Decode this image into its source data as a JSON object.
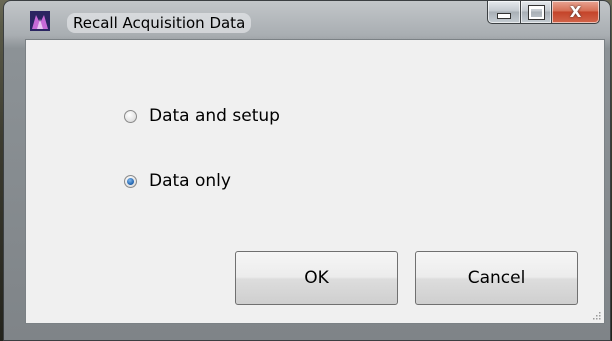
{
  "window": {
    "title": "Recall Acquisition Data",
    "close_glyph": "X"
  },
  "options": [
    {
      "label": "Data and setup",
      "checked": false
    },
    {
      "label": "Data only",
      "checked": true
    }
  ],
  "buttons": {
    "ok_label": "OK",
    "cancel_label": "Cancel"
  },
  "colors": {
    "close_button": "#c4442a",
    "radio_selected": "#1d5fab",
    "client_background": "#f0f0f0"
  }
}
